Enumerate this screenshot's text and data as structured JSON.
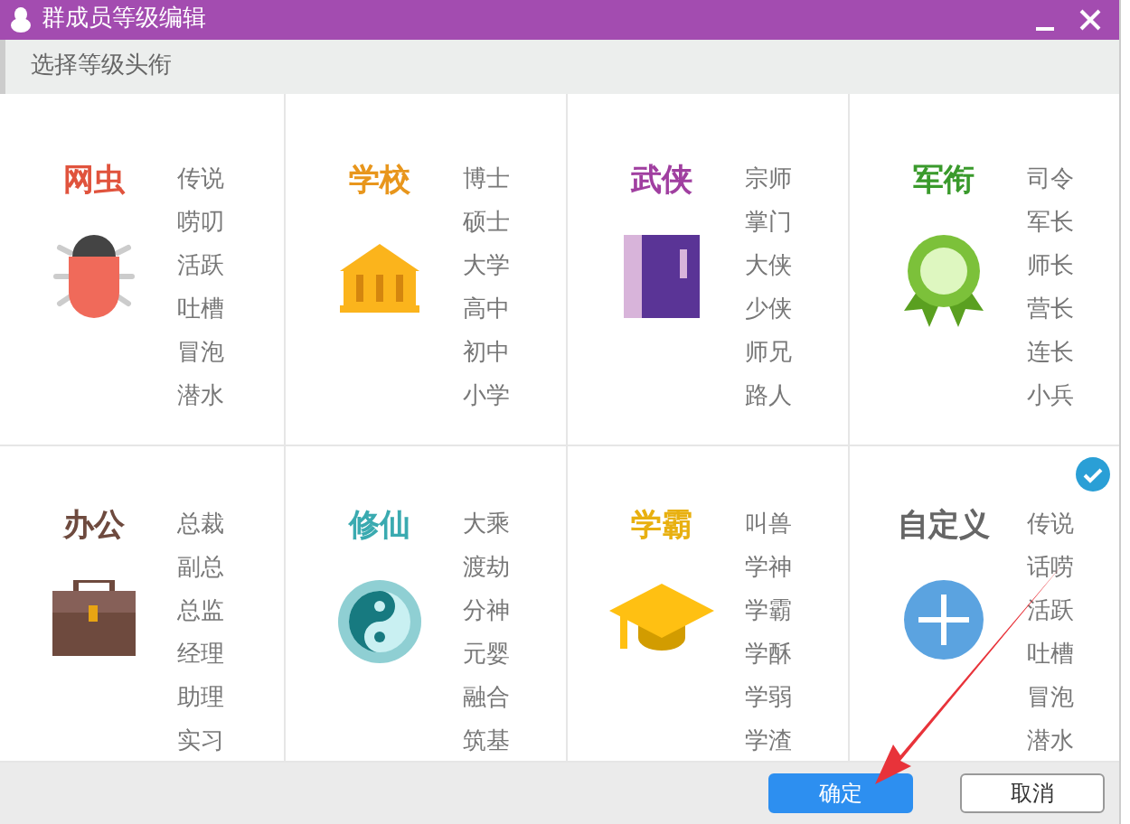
{
  "window": {
    "title": "群成员等级编辑"
  },
  "subheader": "选择等级头衔",
  "categories": [
    {
      "title": "网虫",
      "color": "#e0533d",
      "kind": "bug",
      "selected": false,
      "levels": [
        "传说",
        "唠叨",
        "活跃",
        "吐槽",
        "冒泡",
        "潜水"
      ]
    },
    {
      "title": "学校",
      "color": "#e8961c",
      "kind": "building",
      "selected": false,
      "levels": [
        "博士",
        "硕士",
        "大学",
        "高中",
        "初中",
        "小学"
      ]
    },
    {
      "title": "武侠",
      "color": "#a03fa0",
      "kind": "book",
      "selected": false,
      "levels": [
        "宗师",
        "掌门",
        "大侠",
        "少侠",
        "师兄",
        "路人"
      ]
    },
    {
      "title": "军衔",
      "color": "#3a9a2c",
      "kind": "medal",
      "selected": false,
      "levels": [
        "司令",
        "军长",
        "师长",
        "营长",
        "连长",
        "小兵"
      ]
    },
    {
      "title": "办公",
      "color": "#6e4a3e",
      "kind": "briefcase",
      "selected": false,
      "levels": [
        "总裁",
        "副总",
        "总监",
        "经理",
        "助理",
        "实习"
      ]
    },
    {
      "title": "修仙",
      "color": "#3aaab0",
      "kind": "yinyang",
      "selected": false,
      "levels": [
        "大乘",
        "渡劫",
        "分神",
        "元婴",
        "融合",
        "筑基"
      ]
    },
    {
      "title": "学霸",
      "color": "#e8b010",
      "kind": "gradcap",
      "selected": false,
      "levels": [
        "叫兽",
        "学神",
        "学霸",
        "学酥",
        "学弱",
        "学渣"
      ]
    },
    {
      "title": "自定义",
      "color": "#666666",
      "kind": "plus",
      "selected": true,
      "levels": [
        "传说",
        "话唠",
        "活跃",
        "吐槽",
        "冒泡",
        "潜水"
      ]
    }
  ],
  "buttons": [
    {
      "label": "确定",
      "kind": "primary"
    },
    {
      "label": "取消",
      "kind": "secondary"
    }
  ]
}
